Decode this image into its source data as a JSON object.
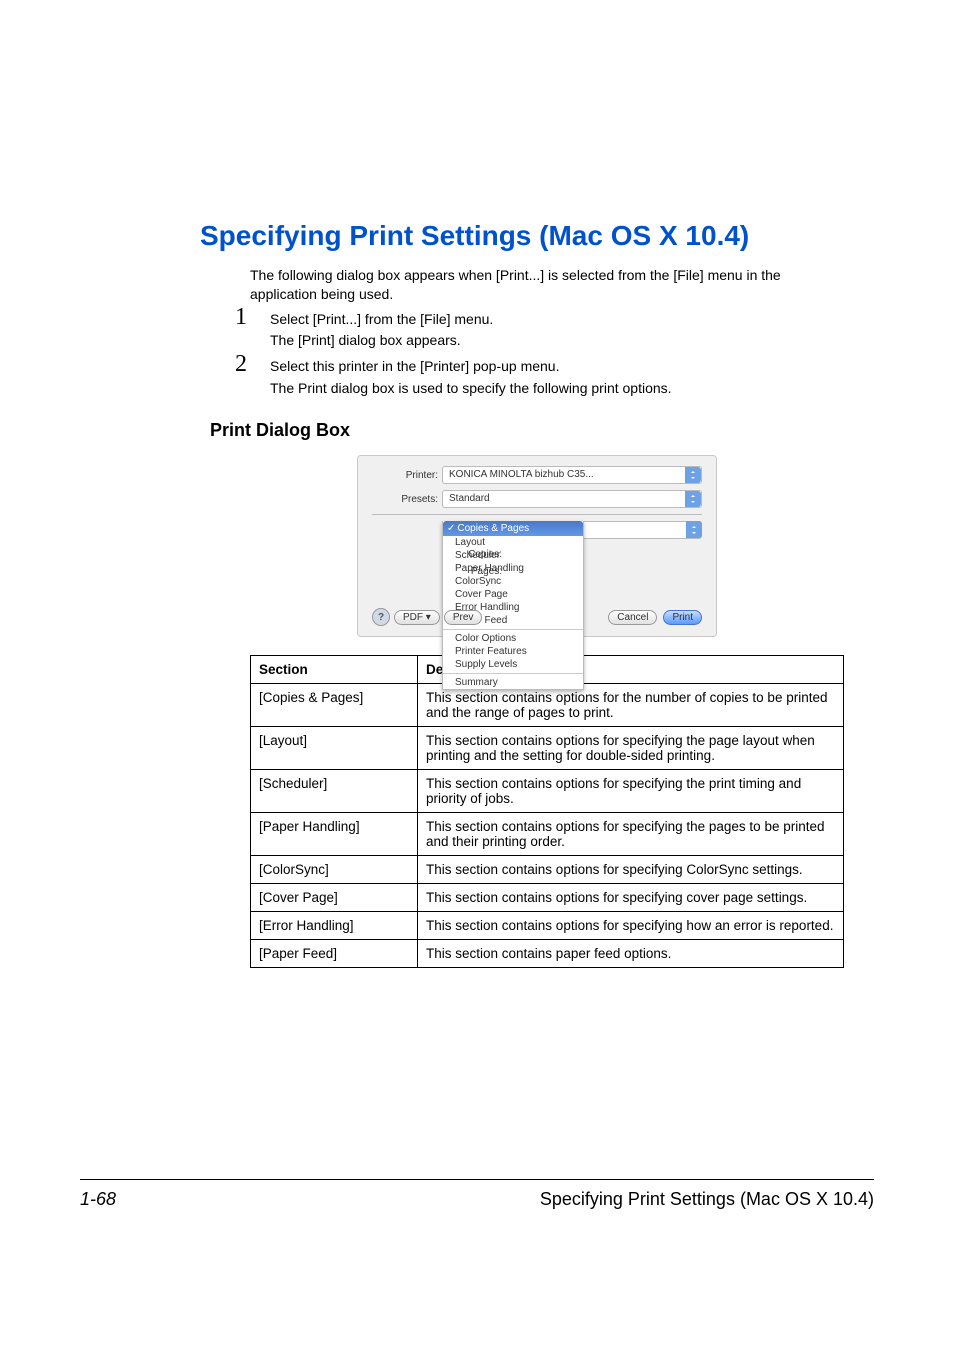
{
  "heading": "Specifying Print Settings (Mac OS X 10.4)",
  "intro": "The following dialog box appears when [Print...] is selected from the [File] menu in the application being used.",
  "steps": [
    {
      "num": "1",
      "body": "Select [Print...] from the [File] menu.",
      "sub": "The [Print] dialog box appears."
    },
    {
      "num": "2",
      "body": "Select this printer in the [Printer] pop-up menu.",
      "sub": "The Print dialog box is used to specify the following print options."
    }
  ],
  "subheading": "Print Dialog Box",
  "dialog": {
    "labels": {
      "printer": "Printer:",
      "presets": "Presets:",
      "copies": "Copies:",
      "pages": "Pages:"
    },
    "printer_value": "KONICA MINOLTA bizhub C35...",
    "presets_value": "Standard",
    "section_selected": "Copies & Pages",
    "section_items": [
      "Layout",
      "Scheduler",
      "Paper Handling",
      "ColorSync",
      "Cover Page",
      "Error Handling",
      "Paper Feed",
      "Color Options",
      "Printer Features",
      "Supply Levels",
      "Summary"
    ],
    "buttons": {
      "help": "?",
      "pdf": "PDF ▾",
      "preview": "Prev",
      "cancel": "Cancel",
      "print": "Print"
    }
  },
  "table": {
    "headers": {
      "section": "Section",
      "description": "Description"
    },
    "rows": [
      {
        "section": "[Copies & Pages]",
        "desc": "This section contains options for the number of copies to be printed and the range of pages to print."
      },
      {
        "section": "[Layout]",
        "desc": "This section contains options for specifying the page layout when printing and the setting for double-sided printing."
      },
      {
        "section": "[Scheduler]",
        "desc": "This section contains options for specifying the print timing and priority of jobs."
      },
      {
        "section": "[Paper Handling]",
        "desc": "This section contains options for specifying the pages to be printed and their printing order."
      },
      {
        "section": "[ColorSync]",
        "desc": "This section contains options for specifying ColorSync settings."
      },
      {
        "section": "[Cover Page]",
        "desc": "This section contains options for specifying cover page settings."
      },
      {
        "section": "[Error Handling]",
        "desc": "This section contains options for specifying how an error is reported."
      },
      {
        "section": "[Paper Feed]",
        "desc": "This section contains paper feed options."
      }
    ]
  },
  "footer": {
    "page": "1-68",
    "title": "Specifying Print Settings (Mac OS X 10.4)"
  }
}
